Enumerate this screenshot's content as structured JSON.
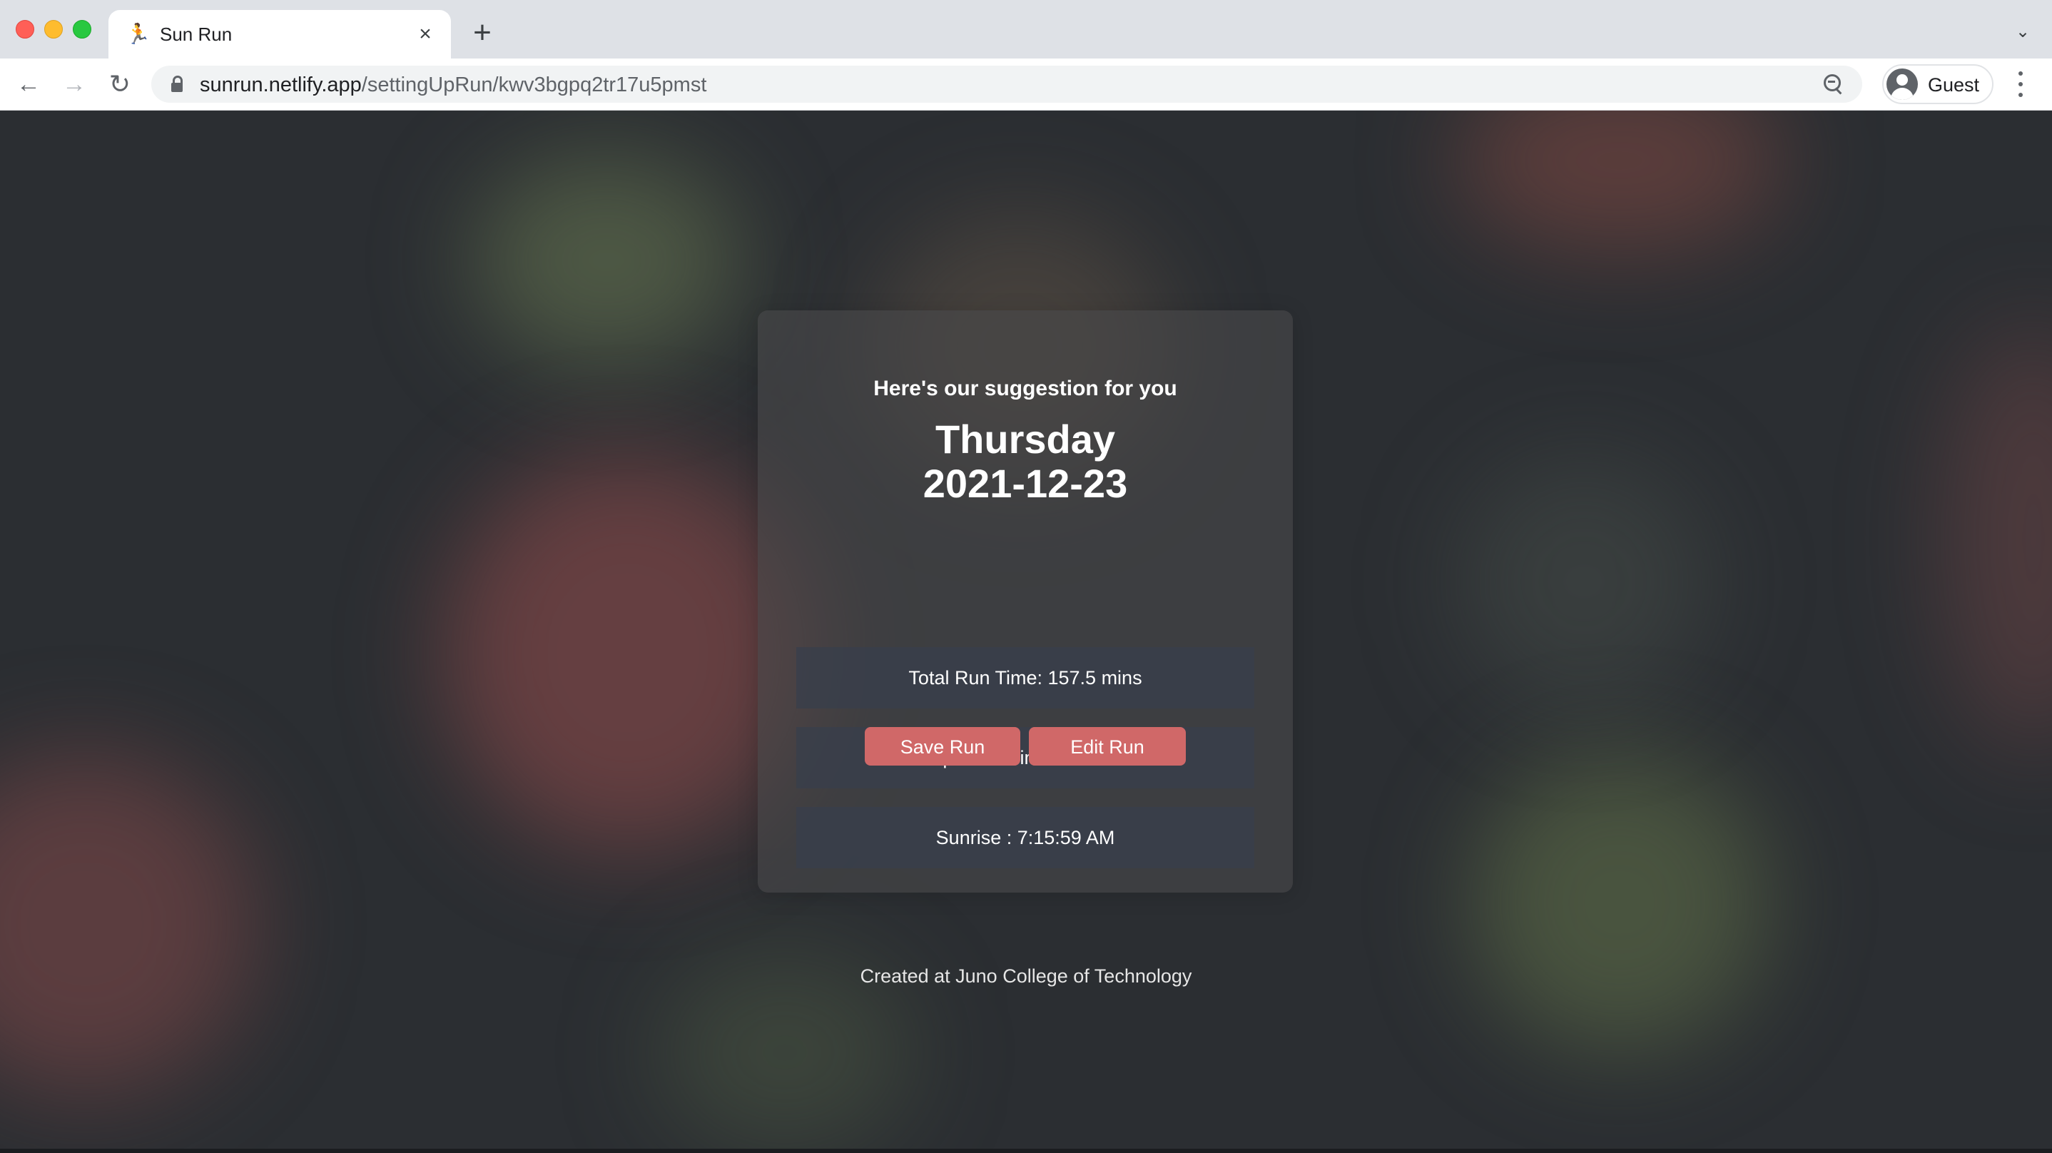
{
  "browser": {
    "tab_title": "Sun Run",
    "tab_favicon": "runner-icon",
    "url_host": "sunrun.netlify.app",
    "url_path": "/settingUpRun/kwv3bgpq2tr17u5pmst",
    "profile_label": "Guest"
  },
  "card": {
    "subtitle": "Here's our suggestion for you",
    "day": "Thursday",
    "date": "2021-12-23",
    "total_run_time": "Total Run Time: 157.5 mins",
    "departure_time": "Departure Time: 5:56 AM",
    "sunrise": "Sunrise : 7:15:59 AM",
    "save_label": "Save Run",
    "edit_label": "Edit Run"
  },
  "footer": {
    "text": "Created at Juno College of Technology"
  },
  "colors": {
    "button": "#d06868",
    "page_background": "#2b2e32",
    "info_box": "#373f4c"
  }
}
